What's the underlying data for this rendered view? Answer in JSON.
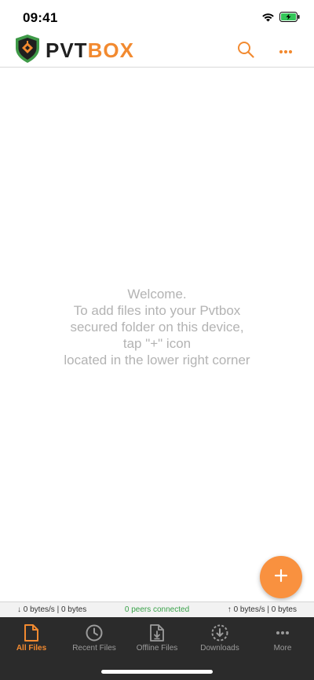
{
  "status_bar": {
    "time": "09:41",
    "icons": [
      "wifi-icon",
      "battery-charging-icon"
    ]
  },
  "header": {
    "logo_part1": "PVT",
    "logo_part2": "BOX",
    "logo_icon": "shield-logo-icon",
    "actions": [
      "search-icon",
      "more-dots-icon"
    ]
  },
  "welcome": {
    "lines": [
      "Welcome.",
      "To add files into your Pvtbox",
      "secured folder on this device,",
      "tap \"+\" icon",
      "located in the lower right corner"
    ]
  },
  "fab": {
    "icon": "plus-icon"
  },
  "transfer": {
    "download": "↓ 0 bytes/s | 0 bytes",
    "peers": "0 peers connected",
    "upload": "↑ 0 bytes/s | 0 bytes"
  },
  "tabs": [
    {
      "label": "All Files",
      "icon": "file-icon",
      "active": true
    },
    {
      "label": "Recent Files",
      "icon": "clock-icon",
      "active": false
    },
    {
      "label": "Offline Files",
      "icon": "offline-file-icon",
      "active": false
    },
    {
      "label": "Downloads",
      "icon": "download-icon",
      "active": false
    },
    {
      "label": "More",
      "icon": "more-dots-icon",
      "active": false
    }
  ],
  "colors": {
    "accent": "#f28a30",
    "fab": "#f9913f",
    "tab_bar": "#2b2b2b",
    "peers_text": "#3aa24a",
    "welcome_text": "#b3b3b3"
  }
}
